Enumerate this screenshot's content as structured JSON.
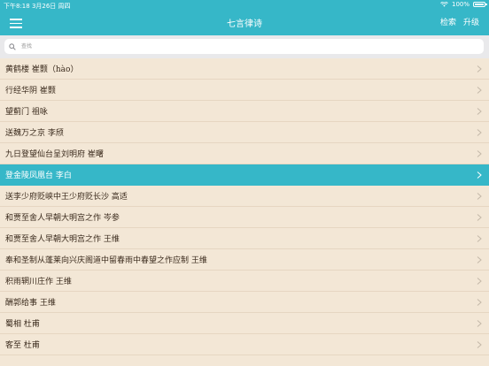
{
  "status_bar": {
    "time_date": "下午8:18  3月26日 周四",
    "battery": "100%"
  },
  "nav": {
    "title": "七言律诗",
    "search_label": "检索",
    "upgrade_label": "升级"
  },
  "search": {
    "placeholder": "查找"
  },
  "colors": {
    "accent": "#36b7c8",
    "row_bg": "#f3e7d6"
  },
  "poems": [
    "黄鹤楼 崔颢（hào）",
    "行经华阴 崔颢",
    "望蓟门 祖咏",
    "送魏万之京 李颀",
    "九日登望仙台呈刘明府 崔曙",
    "登金陵凤凰台 李白",
    "送李少府贬峡中王少府贬长沙 高适",
    "和贾至舍人早朝大明宫之作 岑参",
    "和贾至舍人早朝大明宫之作 王维",
    "奉和圣制从蓬莱向兴庆阁道中留春雨中春望之作应制 王维",
    "积雨辋川庄作 王维",
    "酬郭给事 王维",
    "蜀相 杜甫",
    "客至 杜甫"
  ],
  "selected_index": 5
}
